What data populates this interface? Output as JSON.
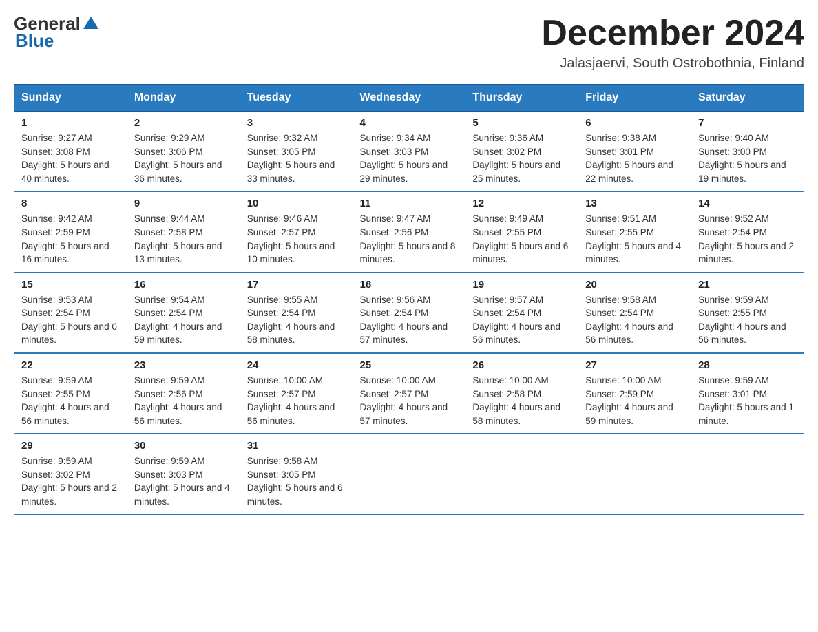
{
  "header": {
    "logo_general": "General",
    "logo_blue": "Blue",
    "month_year": "December 2024",
    "location": "Jalasjaervi, South Ostrobothnia, Finland"
  },
  "days_of_week": [
    "Sunday",
    "Monday",
    "Tuesday",
    "Wednesday",
    "Thursday",
    "Friday",
    "Saturday"
  ],
  "weeks": [
    [
      {
        "day": "1",
        "sunrise": "9:27 AM",
        "sunset": "3:08 PM",
        "daylight": "5 hours and 40 minutes."
      },
      {
        "day": "2",
        "sunrise": "9:29 AM",
        "sunset": "3:06 PM",
        "daylight": "5 hours and 36 minutes."
      },
      {
        "day": "3",
        "sunrise": "9:32 AM",
        "sunset": "3:05 PM",
        "daylight": "5 hours and 33 minutes."
      },
      {
        "day": "4",
        "sunrise": "9:34 AM",
        "sunset": "3:03 PM",
        "daylight": "5 hours and 29 minutes."
      },
      {
        "day": "5",
        "sunrise": "9:36 AM",
        "sunset": "3:02 PM",
        "daylight": "5 hours and 25 minutes."
      },
      {
        "day": "6",
        "sunrise": "9:38 AM",
        "sunset": "3:01 PM",
        "daylight": "5 hours and 22 minutes."
      },
      {
        "day": "7",
        "sunrise": "9:40 AM",
        "sunset": "3:00 PM",
        "daylight": "5 hours and 19 minutes."
      }
    ],
    [
      {
        "day": "8",
        "sunrise": "9:42 AM",
        "sunset": "2:59 PM",
        "daylight": "5 hours and 16 minutes."
      },
      {
        "day": "9",
        "sunrise": "9:44 AM",
        "sunset": "2:58 PM",
        "daylight": "5 hours and 13 minutes."
      },
      {
        "day": "10",
        "sunrise": "9:46 AM",
        "sunset": "2:57 PM",
        "daylight": "5 hours and 10 minutes."
      },
      {
        "day": "11",
        "sunrise": "9:47 AM",
        "sunset": "2:56 PM",
        "daylight": "5 hours and 8 minutes."
      },
      {
        "day": "12",
        "sunrise": "9:49 AM",
        "sunset": "2:55 PM",
        "daylight": "5 hours and 6 minutes."
      },
      {
        "day": "13",
        "sunrise": "9:51 AM",
        "sunset": "2:55 PM",
        "daylight": "5 hours and 4 minutes."
      },
      {
        "day": "14",
        "sunrise": "9:52 AM",
        "sunset": "2:54 PM",
        "daylight": "5 hours and 2 minutes."
      }
    ],
    [
      {
        "day": "15",
        "sunrise": "9:53 AM",
        "sunset": "2:54 PM",
        "daylight": "5 hours and 0 minutes."
      },
      {
        "day": "16",
        "sunrise": "9:54 AM",
        "sunset": "2:54 PM",
        "daylight": "4 hours and 59 minutes."
      },
      {
        "day": "17",
        "sunrise": "9:55 AM",
        "sunset": "2:54 PM",
        "daylight": "4 hours and 58 minutes."
      },
      {
        "day": "18",
        "sunrise": "9:56 AM",
        "sunset": "2:54 PM",
        "daylight": "4 hours and 57 minutes."
      },
      {
        "day": "19",
        "sunrise": "9:57 AM",
        "sunset": "2:54 PM",
        "daylight": "4 hours and 56 minutes."
      },
      {
        "day": "20",
        "sunrise": "9:58 AM",
        "sunset": "2:54 PM",
        "daylight": "4 hours and 56 minutes."
      },
      {
        "day": "21",
        "sunrise": "9:59 AM",
        "sunset": "2:55 PM",
        "daylight": "4 hours and 56 minutes."
      }
    ],
    [
      {
        "day": "22",
        "sunrise": "9:59 AM",
        "sunset": "2:55 PM",
        "daylight": "4 hours and 56 minutes."
      },
      {
        "day": "23",
        "sunrise": "9:59 AM",
        "sunset": "2:56 PM",
        "daylight": "4 hours and 56 minutes."
      },
      {
        "day": "24",
        "sunrise": "10:00 AM",
        "sunset": "2:57 PM",
        "daylight": "4 hours and 56 minutes."
      },
      {
        "day": "25",
        "sunrise": "10:00 AM",
        "sunset": "2:57 PM",
        "daylight": "4 hours and 57 minutes."
      },
      {
        "day": "26",
        "sunrise": "10:00 AM",
        "sunset": "2:58 PM",
        "daylight": "4 hours and 58 minutes."
      },
      {
        "day": "27",
        "sunrise": "10:00 AM",
        "sunset": "2:59 PM",
        "daylight": "4 hours and 59 minutes."
      },
      {
        "day": "28",
        "sunrise": "9:59 AM",
        "sunset": "3:01 PM",
        "daylight": "5 hours and 1 minute."
      }
    ],
    [
      {
        "day": "29",
        "sunrise": "9:59 AM",
        "sunset": "3:02 PM",
        "daylight": "5 hours and 2 minutes."
      },
      {
        "day": "30",
        "sunrise": "9:59 AM",
        "sunset": "3:03 PM",
        "daylight": "5 hours and 4 minutes."
      },
      {
        "day": "31",
        "sunrise": "9:58 AM",
        "sunset": "3:05 PM",
        "daylight": "5 hours and 6 minutes."
      },
      null,
      null,
      null,
      null
    ]
  ]
}
